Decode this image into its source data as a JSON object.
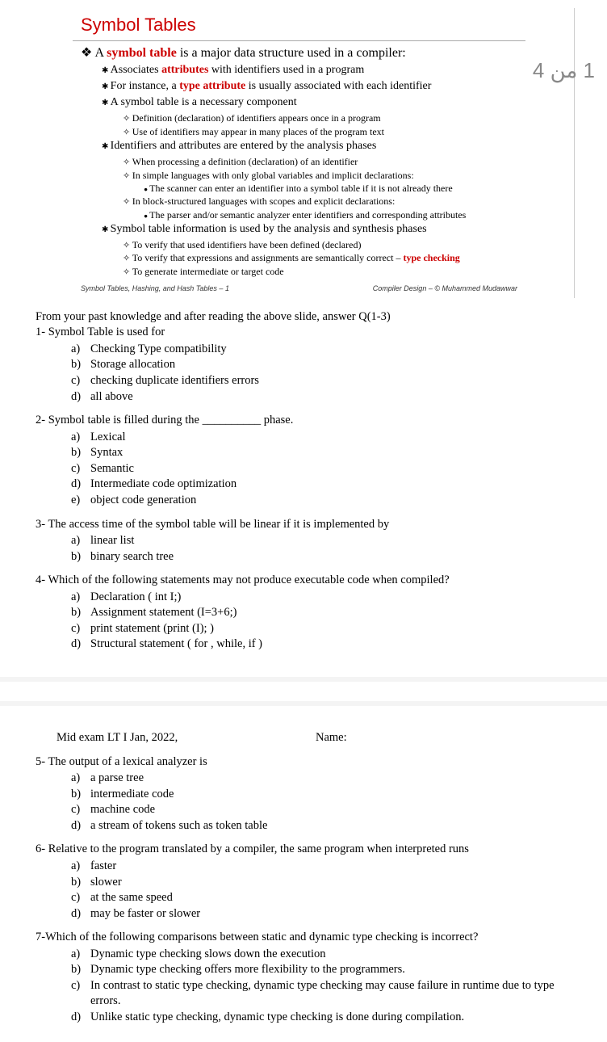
{
  "page_indicator": "1 من 4",
  "slide": {
    "title": "Symbol Tables",
    "l1": "A ",
    "l1_red": "symbol table",
    "l1_b": " is a major data structure used in a compiler:",
    "l2a": "Associates ",
    "l2a_red": "attributes",
    "l2a_b": " with identifiers used in a program",
    "l2b": "For instance, a ",
    "l2b_red": "type attribute",
    "l2b_b": " is usually associated with each identifier",
    "l2c": "A symbol table is a necessary component",
    "l3ca": "Definition (declaration) of identifiers appears once in a program",
    "l3cb": "Use of identifiers may appear in many places of the program text",
    "l2d": "Identifiers and attributes are entered by the analysis phases",
    "l3da": "When processing a definition (declaration) of an identifier",
    "l3db": "In simple languages with only global variables and implicit declarations:",
    "l4dba": "The scanner can enter an identifier into a symbol table if it is not already there",
    "l3dc": "In block-structured languages with scopes and explicit declarations:",
    "l4dca": "The parser and/or semantic analyzer enter identifiers and corresponding attributes",
    "l2e": "Symbol table information is used by the analysis and synthesis phases",
    "l3ea": "To verify that used identifiers have been defined (declared)",
    "l3eb": "To verify that expressions and assignments are semantically correct – ",
    "l3eb_red": "type checking",
    "l3ec": "To generate intermediate or target code",
    "footer_left": "Symbol Tables, Hashing, and Hash Tables – 1",
    "footer_right": "Compiler Design – © Muhammed Mudawwar"
  },
  "questions1": {
    "intro": "From your past knowledge and after reading the above slide, answer Q(1-3)",
    "q1": "1- Symbol Table is used for",
    "q1a": "Checking Type compatibility",
    "q1b": "Storage allocation",
    "q1c": "checking duplicate identifiers errors",
    "q1d": "all above",
    "q2": "2- Symbol table is filled during the __________ phase.",
    "q2a": "Lexical",
    "q2b": "Syntax",
    "q2c": "Semantic",
    "q2d": "Intermediate code optimization",
    "q2e": "object code generation",
    "q3": "3- The access time of the symbol table will be linear if it is implemented by",
    "q3a": "linear list",
    "q3b": "binary search tree",
    "q4": "4- Which of the following statements may not produce executable code when compiled?",
    "q4a": "Declaration ( int I;)",
    "q4b": "Assignment statement (I=3+6;)",
    "q4c": "print statement (print (I); )",
    "q4d": "Structural statement (   for , while, if   )"
  },
  "page2": {
    "header_left": "Mid exam LT I Jan, 2022,",
    "header_right": "Name:",
    "q5": "5- The output of a lexical analyzer is",
    "q5a": "a parse tree",
    "q5b": "intermediate code",
    "q5c": "machine code",
    "q5d": "a stream of tokens such as token table",
    "q6": "6- Relative to the program translated by a compiler, the same program when interpreted runs",
    "q6a": "faster",
    "q6b": "slower",
    "q6c": "at the same speed",
    "q6d": "may be faster or slower",
    "q7": "7-Which of the following comparisons between static and dynamic type checking is incorrect?",
    "q7a": "Dynamic type checking slows down the execution",
    "q7b": "Dynamic type checking offers more flexibility to the programmers.",
    "q7c": "In contrast to static type checking, dynamic type checking may cause failure in runtime due to type errors.",
    "q7d": "Unlike static type checking, dynamic type checking is done during compilation."
  }
}
